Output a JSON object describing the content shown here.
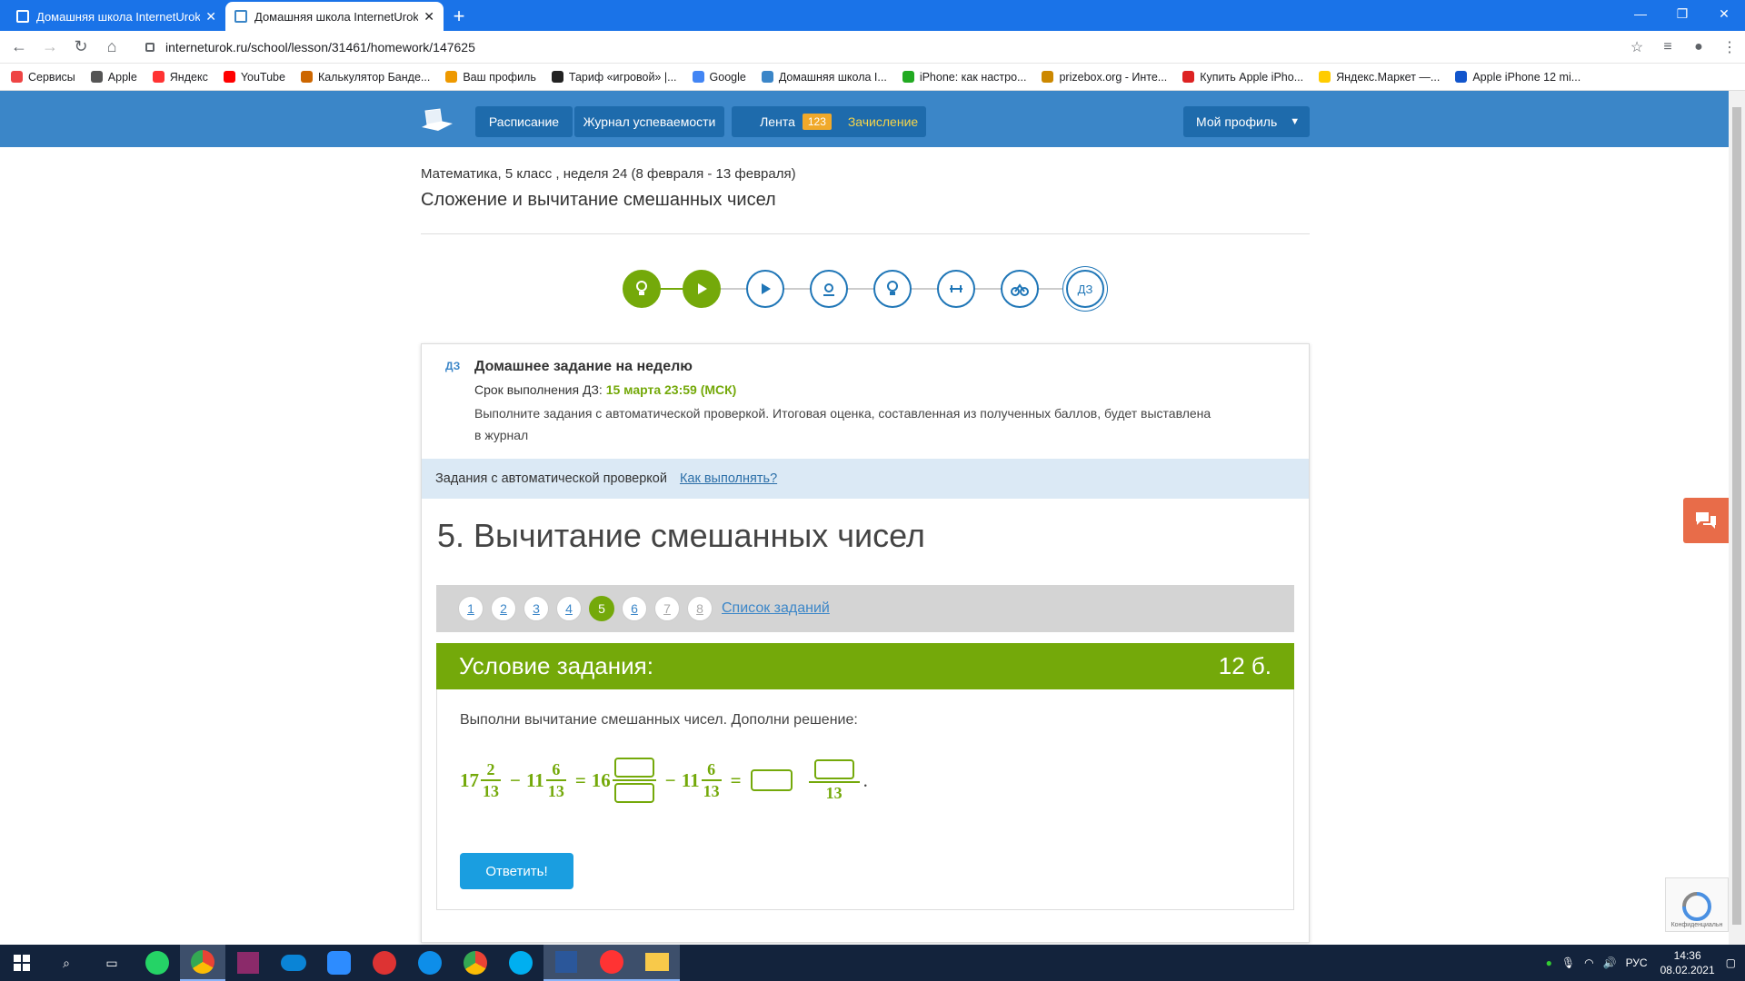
{
  "browser": {
    "tabs": [
      {
        "title": "Домашняя школа InternetUrok.r",
        "active": false
      },
      {
        "title": "Домашняя школа InternetUrok.r",
        "active": true
      }
    ],
    "url": "interneturok.ru/school/lesson/31461/homework/147625",
    "bookmarks": [
      {
        "label": "Сервисы",
        "color": "#e44"
      },
      {
        "label": "Apple",
        "color": "#555"
      },
      {
        "label": "Яндекс",
        "color": "#f33"
      },
      {
        "label": "YouTube",
        "color": "#f00"
      },
      {
        "label": "Калькулятор Банде...",
        "color": "#c60"
      },
      {
        "label": "Ваш профиль",
        "color": "#e90"
      },
      {
        "label": "Тариф «игровой» |...",
        "color": "#222"
      },
      {
        "label": "Google",
        "color": "#4285f4"
      },
      {
        "label": "Домашняя школа I...",
        "color": "#3b86c8"
      },
      {
        "label": "iPhone: как настро...",
        "color": "#2a2"
      },
      {
        "label": "prizebox.org - Инте...",
        "color": "#c80"
      },
      {
        "label": "Купить Apple iPho...",
        "color": "#d22"
      },
      {
        "label": "Яндекс.Маркет —...",
        "color": "#fc0"
      },
      {
        "label": "Apple iPhone 12 mi...",
        "color": "#15c"
      }
    ]
  },
  "header": {
    "nav": [
      {
        "label": "Расписание"
      },
      {
        "label": "Журнал успеваемости"
      },
      {
        "label": "Лента",
        "badge": "123"
      },
      {
        "label": "Зачисление"
      }
    ],
    "profile": "Мой профиль"
  },
  "lesson": {
    "breadcrumb": "Математика, 5 класс , неделя 24 (8 февраля - 13 февраля)",
    "title": "Сложение и вычитание смешанных чисел",
    "steps": [
      {
        "icon": "lightbulb-icon",
        "state": "done"
      },
      {
        "icon": "play-icon",
        "state": "done"
      },
      {
        "icon": "play-icon",
        "state": "todo"
      },
      {
        "icon": "webinar-icon",
        "state": "todo"
      },
      {
        "icon": "lightbulb-icon",
        "state": "todo"
      },
      {
        "icon": "dumbbell-icon",
        "state": "todo"
      },
      {
        "icon": "bike-icon",
        "state": "todo"
      },
      {
        "icon": "homework-icon",
        "label": "ДЗ",
        "state": "current"
      }
    ]
  },
  "homework": {
    "tag": "ДЗ",
    "title": "Домашнее задание на неделю",
    "deadline_label": "Срок выполнения ДЗ:",
    "deadline_value": "15 марта 23:59 (МСК)",
    "description_line1": "Выполните задания с автоматической проверкой. Итоговая оценка, составленная из полученных баллов, будет выставлена",
    "description_line2": "в журнал",
    "auto_check_label": "Задания с автоматической проверкой",
    "how_to_link": "Как выполнять?"
  },
  "task": {
    "title": "5. Вычитание смешанных чисел",
    "numbers": [
      "1",
      "2",
      "3",
      "4",
      "5",
      "6",
      "7",
      "8"
    ],
    "active_number": "5",
    "task_list_link": "Список заданий",
    "condition_label": "Условие задания:",
    "points": "12 б.",
    "prompt": "Выполни вычитание смешанных чисел. Дополни решение:",
    "expression": {
      "a_whole": "17",
      "a_num": "2",
      "a_den": "13",
      "minus": "−",
      "b_whole": "11",
      "b_num": "6",
      "b_den": "13",
      "equals": "=",
      "c_whole": "16",
      "d_whole": "11",
      "d_num": "6",
      "d_den": "13",
      "result_den": "13",
      "period": "."
    },
    "submit": "Ответить!"
  },
  "recaptcha_text": "Конфиденциальн",
  "system": {
    "lang": "РУС",
    "time": "14:36",
    "date": "08.02.2021"
  },
  "colors": {
    "brand_blue": "#3b86c8",
    "green": "#74a90a",
    "button_blue": "#1a9ee0"
  }
}
